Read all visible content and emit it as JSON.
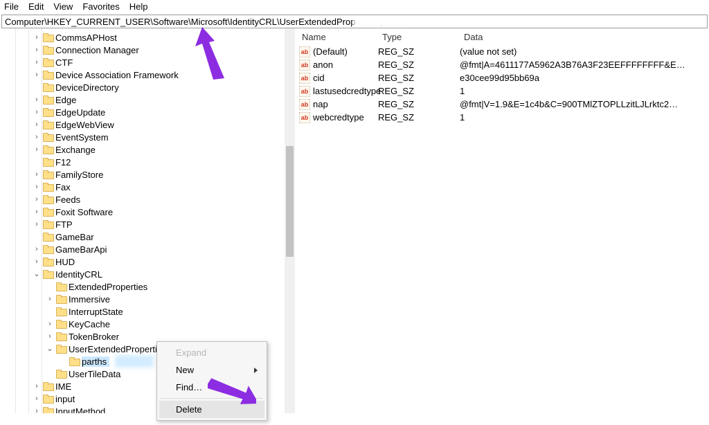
{
  "menu": {
    "file": "File",
    "edit": "Edit",
    "view": "View",
    "favorites": "Favorites",
    "help": "Help"
  },
  "address_path": "Computer\\HKEY_CURRENT_USER\\Software\\Microsoft\\IdentityCRL\\UserExtendedProperties\\parthsh",
  "tree": [
    {
      "depth": 3,
      "exp": "closed",
      "label": "CommsAPHost"
    },
    {
      "depth": 3,
      "exp": "closed",
      "label": "Connection Manager"
    },
    {
      "depth": 3,
      "exp": "closed",
      "label": "CTF"
    },
    {
      "depth": 3,
      "exp": "closed",
      "label": "Device Association Framework"
    },
    {
      "depth": 3,
      "exp": "none",
      "label": "DeviceDirectory"
    },
    {
      "depth": 3,
      "exp": "closed",
      "label": "Edge"
    },
    {
      "depth": 3,
      "exp": "closed",
      "label": "EdgeUpdate"
    },
    {
      "depth": 3,
      "exp": "closed",
      "label": "EdgeWebView"
    },
    {
      "depth": 3,
      "exp": "closed",
      "label": "EventSystem"
    },
    {
      "depth": 3,
      "exp": "closed",
      "label": "Exchange"
    },
    {
      "depth": 3,
      "exp": "none",
      "label": "F12"
    },
    {
      "depth": 3,
      "exp": "closed",
      "label": "FamilyStore"
    },
    {
      "depth": 3,
      "exp": "closed",
      "label": "Fax"
    },
    {
      "depth": 3,
      "exp": "closed",
      "label": "Feeds"
    },
    {
      "depth": 3,
      "exp": "closed",
      "label": "Foxit Software"
    },
    {
      "depth": 3,
      "exp": "closed",
      "label": "FTP"
    },
    {
      "depth": 3,
      "exp": "none",
      "label": "GameBar"
    },
    {
      "depth": 3,
      "exp": "closed",
      "label": "GameBarApi"
    },
    {
      "depth": 3,
      "exp": "closed",
      "label": "HUD"
    },
    {
      "depth": 3,
      "exp": "open",
      "label": "IdentityCRL"
    },
    {
      "depth": 4,
      "exp": "none",
      "label": "ExtendedProperties"
    },
    {
      "depth": 4,
      "exp": "closed",
      "label": "Immersive"
    },
    {
      "depth": 4,
      "exp": "none",
      "label": "InterruptState"
    },
    {
      "depth": 4,
      "exp": "closed",
      "label": "KeyCache"
    },
    {
      "depth": 4,
      "exp": "closed",
      "label": "TokenBroker"
    },
    {
      "depth": 4,
      "exp": "open",
      "label": "UserExtendedProperties"
    },
    {
      "depth": 5,
      "exp": "none",
      "label": "parths",
      "selected": true,
      "blurred": true
    },
    {
      "depth": 4,
      "exp": "none",
      "label": "UserTileData"
    },
    {
      "depth": 3,
      "exp": "closed",
      "label": "IME"
    },
    {
      "depth": 3,
      "exp": "closed",
      "label": "input"
    },
    {
      "depth": 3,
      "exp": "closed",
      "label": "InputMethod"
    }
  ],
  "list": {
    "columns": {
      "name": "Name",
      "type": "Type",
      "data": "Data"
    },
    "col_widths": {
      "name": 120,
      "type": 118,
      "data": 340
    },
    "rows": [
      {
        "name": "(Default)",
        "type": "REG_SZ",
        "data": "(value not set)"
      },
      {
        "name": "anon",
        "type": "REG_SZ",
        "data": "@fmt|A=4611177A5962A3B76A3F23EEFFFFFFFF&E…"
      },
      {
        "name": "cid",
        "type": "REG_SZ",
        "data": "e30cee99d95bb69a"
      },
      {
        "name": "lastusedcredtype",
        "type": "REG_SZ",
        "data": "1"
      },
      {
        "name": "nap",
        "type": "REG_SZ",
        "data": "@fmt|V=1.9&E=1c4b&C=900TMlZTOPLLzitLJLrktc2…"
      },
      {
        "name": "webcredtype",
        "type": "REG_SZ",
        "data": "1"
      }
    ]
  },
  "context_menu": {
    "expand": "Expand",
    "new": "New",
    "find": "Find…",
    "delete": "Delete"
  },
  "arrow_color": "#8C2DE2"
}
